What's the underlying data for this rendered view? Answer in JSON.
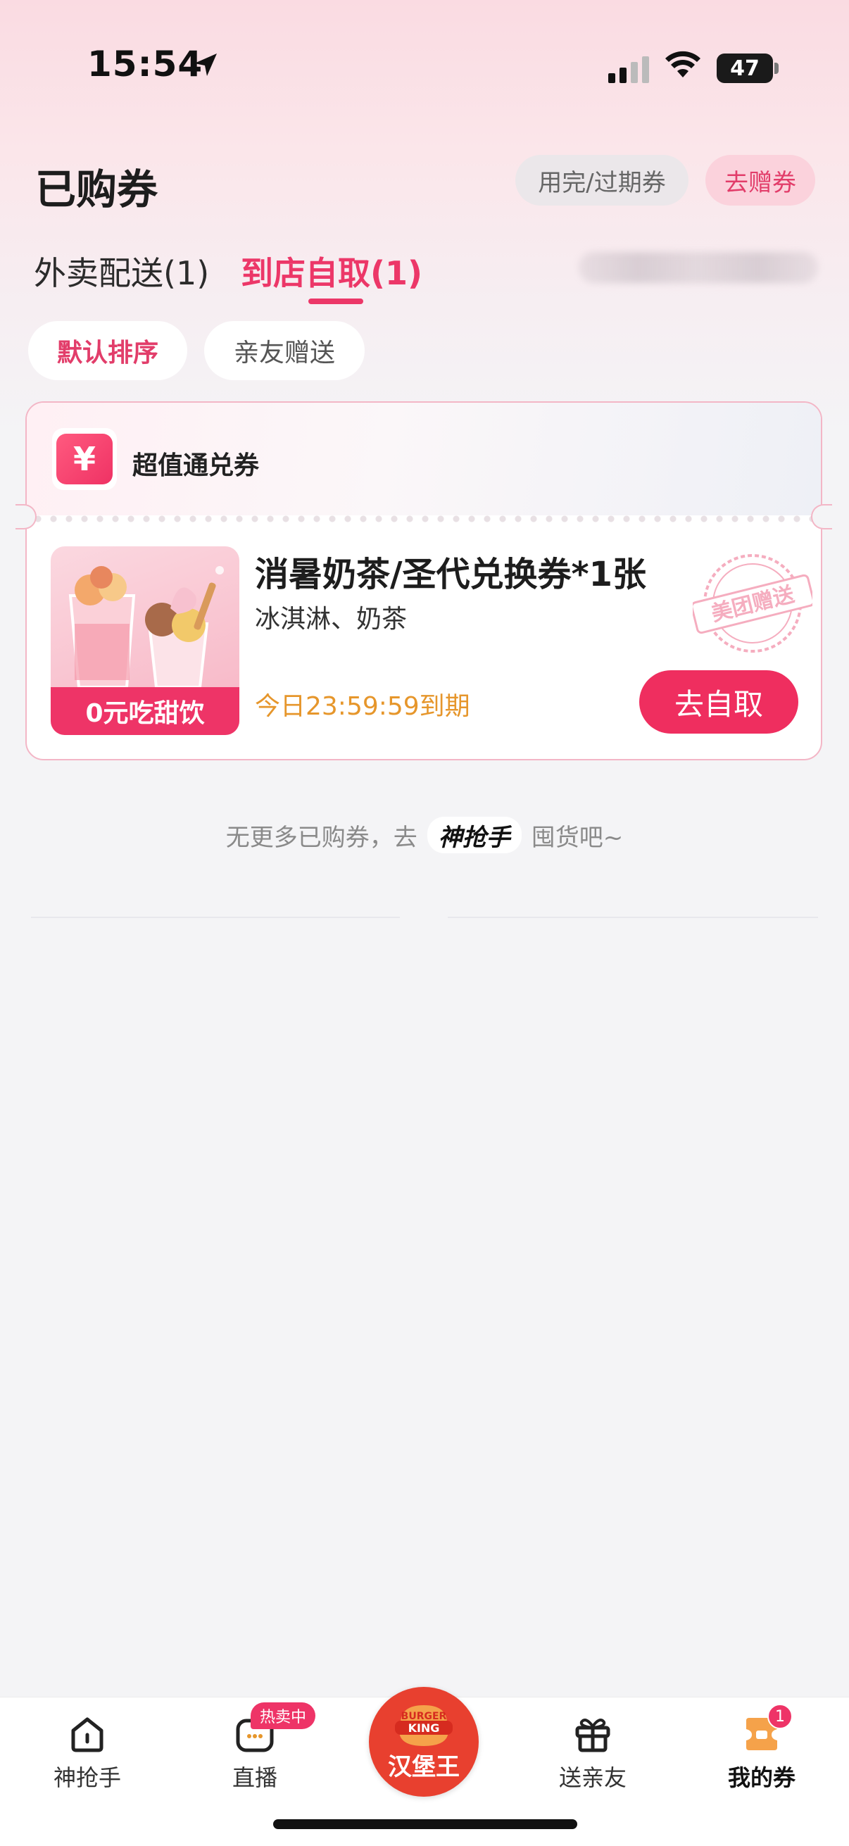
{
  "status_bar": {
    "time": "15:54",
    "battery": "47"
  },
  "header": {
    "title": "已购券",
    "expired_button": "用完/过期券",
    "gift_button": "去赠券"
  },
  "tabs": [
    {
      "label": "外卖配送(1)"
    },
    {
      "label": "到店自取(1)"
    }
  ],
  "filters": [
    {
      "label": "默认排序"
    },
    {
      "label": "亲友赠送"
    }
  ],
  "coupon": {
    "type_label": "超值通兑券",
    "yen_symbol": "¥",
    "image_caption": "0元吃甜饮",
    "title": "消暑奶茶/圣代兑换券*1张",
    "category": "冰淇淋、奶茶",
    "expiry": "今日23:59:59到期",
    "action_button": "去自取",
    "stamp_text": "美团赠送"
  },
  "footer_note": {
    "prefix": "无更多已购券，去",
    "brand": "神抢手",
    "suffix": "囤货吧~"
  },
  "tabbar": {
    "items": [
      {
        "label": "神抢手"
      },
      {
        "label": "直播",
        "badge": "热卖中"
      },
      {
        "label": "汉堡王",
        "logo_top": "BURGER",
        "logo_bottom": "KING"
      },
      {
        "label": "送亲友"
      },
      {
        "label": "我的券",
        "badge": "1"
      }
    ]
  },
  "colors": {
    "accent": "#ec3768",
    "expiry": "#e6962b",
    "burger_king": "#e8402f"
  }
}
